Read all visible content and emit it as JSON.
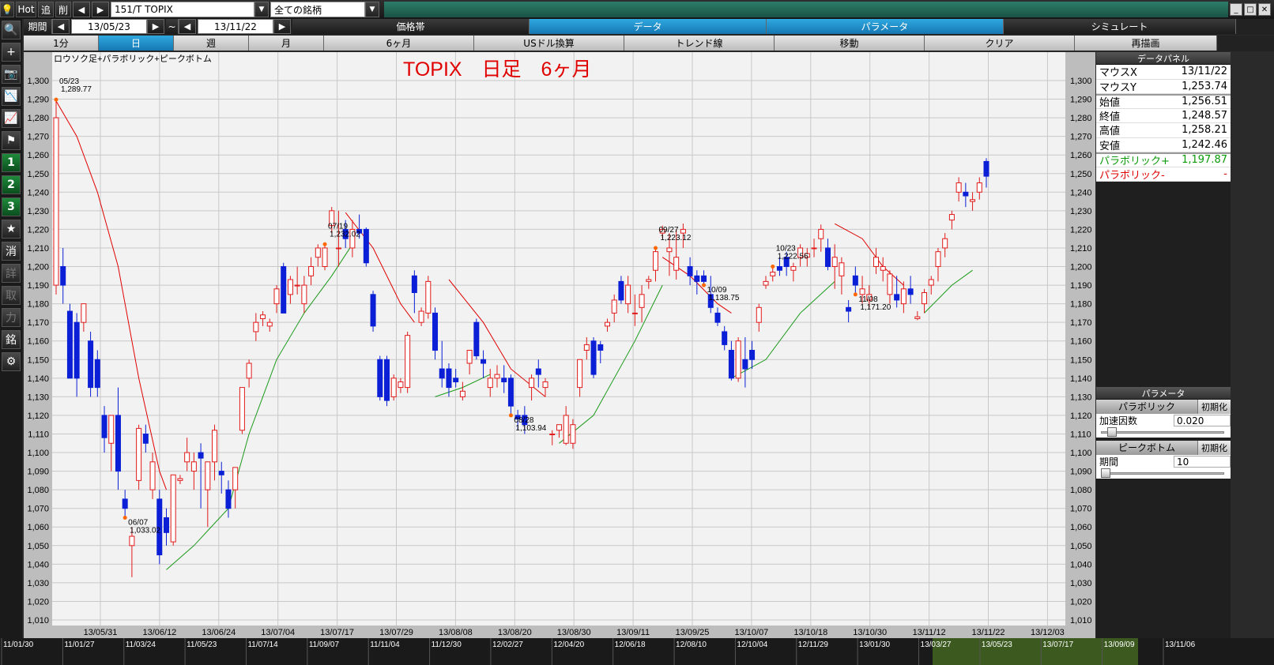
{
  "topbar": {
    "hot_label": "Hot",
    "add_label": "追",
    "del_label": "削",
    "prev_icon": "triangle-left-icon",
    "next_icon": "triangle-right-icon",
    "symbol_value": "151/T TOPIX",
    "filter_value": "全ての銘柄"
  },
  "row2": {
    "period_label": "期間",
    "start_date": "13/05/23",
    "tilde": "~",
    "end_date": "13/11/22",
    "tabs": [
      {
        "label": "価格帯"
      },
      {
        "label": "データ"
      },
      {
        "label": "パラメータ"
      },
      {
        "label": "シミュレート"
      }
    ]
  },
  "row3": {
    "buttons": [
      {
        "label": "1分"
      },
      {
        "label": "日"
      },
      {
        "label": "週"
      },
      {
        "label": "月"
      },
      {
        "label": "6ヶ月"
      },
      {
        "label": "USドル換算"
      },
      {
        "label": "トレンド線"
      },
      {
        "label": "移動"
      },
      {
        "label": "クリア"
      },
      {
        "label": "再描画"
      }
    ]
  },
  "left_tools": [
    {
      "icon": "magnifier-icon",
      "label": ""
    },
    {
      "icon": "plus-icon",
      "label": ""
    },
    {
      "icon": "camera-icon",
      "label": ""
    },
    {
      "icon": "line-chart-icon",
      "label": ""
    },
    {
      "icon": "indicator-chart-icon",
      "label": ""
    },
    {
      "icon": "flag-icon",
      "label": ""
    },
    {
      "icon": "",
      "label": "1"
    },
    {
      "icon": "",
      "label": "2"
    },
    {
      "icon": "",
      "label": "3"
    },
    {
      "icon": "star-icon",
      "label": ""
    },
    {
      "icon": "",
      "label": "消"
    },
    {
      "icon": "",
      "label": "詳"
    },
    {
      "icon": "",
      "label": "取"
    },
    {
      "icon": "",
      "label": "力"
    },
    {
      "icon": "",
      "label": "銘"
    },
    {
      "icon": "gear-icon",
      "label": ""
    }
  ],
  "chart_data": {
    "type": "candlestick",
    "subtitle": "ロウソク足+パラボリック+ピークボトム",
    "title": "TOPIX　日足　6ヶ月",
    "y_ticks": [
      "1,300",
      "1,290",
      "1,280",
      "1,270",
      "1,260",
      "1,250",
      "1,240",
      "1,230",
      "1,220",
      "1,210",
      "1,200",
      "1,190",
      "1,180",
      "1,170",
      "1,160",
      "1,150",
      "1,140",
      "1,130",
      "1,120",
      "1,110",
      "1,100",
      "1,090",
      "1,080",
      "1,070",
      "1,060",
      "1,050",
      "1,040",
      "1,030",
      "1,020",
      "1,010"
    ],
    "ylim": [
      1010,
      1300
    ],
    "x_ticks": [
      "13/05/31",
      "13/06/12",
      "13/06/24",
      "13/07/04",
      "13/07/17",
      "13/07/29",
      "13/08/08",
      "13/08/20",
      "13/08/30",
      "13/09/11",
      "13/09/25",
      "13/10/07",
      "13/10/18",
      "13/10/30",
      "13/11/12",
      "13/11/22",
      "13/12/03"
    ],
    "peak_labels": [
      {
        "date": "05/23",
        "value": "1,289.77",
        "type": "peak",
        "i": 0
      },
      {
        "date": "06/07",
        "value": "1,033.02",
        "type": "bottom",
        "i": 10
      },
      {
        "date": "07/19",
        "value": "1,232.02",
        "type": "peak",
        "i": 39
      },
      {
        "date": "08/28",
        "value": "1,103.94",
        "type": "bottom",
        "i": 66
      },
      {
        "date": "09/27",
        "value": "1,223.12",
        "type": "peak",
        "i": 87
      },
      {
        "date": "10/09",
        "value": "1,138.75",
        "type": "bottom",
        "i": 94
      },
      {
        "date": "10/23",
        "value": "1,222.56",
        "type": "peak",
        "i": 104
      },
      {
        "date": "11/08",
        "value": "1,171.20",
        "type": "bottom",
        "i": 116
      }
    ],
    "candles": [
      [
        1190,
        1289.77,
        1185,
        1280
      ],
      [
        1200,
        1210,
        1180,
        1190
      ],
      [
        1176,
        1180,
        1140,
        1140
      ],
      [
        1170,
        1175,
        1130,
        1140
      ],
      [
        1170,
        1180,
        1165,
        1180
      ],
      [
        1160,
        1165,
        1130,
        1135
      ],
      [
        1150,
        1155,
        1130,
        1135
      ],
      [
        1120,
        1125,
        1100,
        1108
      ],
      [
        1105,
        1120,
        1090,
        1120
      ],
      [
        1120,
        1135,
        1080,
        1090
      ],
      [
        1075,
        1080,
        1065,
        1070
      ],
      [
        1050,
        1060,
        1033.02,
        1055
      ],
      [
        1085,
        1115,
        1080,
        1113
      ],
      [
        1110,
        1115,
        1100,
        1105
      ],
      [
        1080,
        1100,
        1075,
        1095
      ],
      [
        1075,
        1080,
        1040,
        1045
      ],
      [
        1065,
        1070,
        1050,
        1057
      ],
      [
        1052,
        1088,
        1050,
        1088
      ],
      [
        1085,
        1088,
        1083,
        1086
      ],
      [
        1095,
        1108,
        1090,
        1100
      ],
      [
        1090,
        1100,
        1080,
        1095
      ],
      [
        1100,
        1105,
        1070,
        1097
      ],
      [
        1080,
        1090,
        1060,
        1095
      ],
      [
        1095,
        1115,
        1085,
        1112
      ],
      [
        1090,
        1095,
        1078,
        1088
      ],
      [
        1080,
        1085,
        1065,
        1070
      ],
      [
        1080,
        1090,
        1070,
        1092
      ],
      [
        1112,
        1135,
        1110,
        1135
      ],
      [
        1140,
        1150,
        1135,
        1148
      ],
      [
        1165,
        1175,
        1160,
        1170
      ],
      [
        1172,
        1176,
        1168,
        1174
      ],
      [
        1168,
        1172,
        1165,
        1170
      ],
      [
        1180,
        1190,
        1175,
        1188
      ],
      [
        1200,
        1202,
        1175,
        1175
      ],
      [
        1185,
        1195,
        1180,
        1193
      ],
      [
        1190,
        1200,
        1185,
        1190
      ],
      [
        1180,
        1195,
        1175,
        1190
      ],
      [
        1195,
        1205,
        1190,
        1200
      ],
      [
        1205,
        1212,
        1200,
        1210
      ],
      [
        1200,
        1212,
        1198,
        1210
      ],
      [
        1222,
        1232.02,
        1218,
        1230
      ],
      [
        1210,
        1230,
        1200,
        1210
      ],
      [
        1220,
        1225,
        1210,
        1215
      ],
      [
        1210,
        1225,
        1205,
        1220
      ],
      [
        1220,
        1228,
        1215,
        1218
      ],
      [
        1220,
        1221,
        1200,
        1202
      ],
      [
        1185,
        1187,
        1165,
        1168
      ],
      [
        1150,
        1152,
        1128,
        1130
      ],
      [
        1150,
        1152,
        1125,
        1128
      ],
      [
        1130,
        1142,
        1128,
        1140
      ],
      [
        1135,
        1140,
        1132,
        1138
      ],
      [
        1135,
        1165,
        1132,
        1163
      ],
      [
        1195,
        1198,
        1175,
        1186
      ],
      [
        1170,
        1178,
        1168,
        1176
      ],
      [
        1175,
        1195,
        1172,
        1192
      ],
      [
        1175,
        1178,
        1150,
        1155
      ],
      [
        1145,
        1160,
        1135,
        1140
      ],
      [
        1145,
        1148,
        1130,
        1135
      ],
      [
        1140,
        1145,
        1135,
        1138
      ],
      [
        1130,
        1138,
        1128,
        1133
      ],
      [
        1148,
        1155,
        1142,
        1155
      ],
      [
        1170,
        1172,
        1150,
        1152
      ],
      [
        1150,
        1155,
        1140,
        1148
      ],
      [
        1135,
        1145,
        1130,
        1140
      ],
      [
        1140,
        1147,
        1135,
        1142
      ],
      [
        1140,
        1147,
        1132,
        1138
      ],
      [
        1140,
        1142,
        1120,
        1125
      ],
      [
        1120,
        1123,
        1112,
        1118
      ],
      [
        1120,
        1125,
        1110,
        1115
      ],
      [
        1135,
        1142,
        1128,
        1140
      ],
      [
        1145,
        1150,
        1135,
        1142
      ],
      [
        1135,
        1140,
        1130,
        1138
      ],
      [
        1110,
        1112,
        1103.94,
        1110
      ],
      [
        1112,
        1115,
        1108,
        1115
      ],
      [
        1105,
        1125,
        1104,
        1120
      ],
      [
        1105,
        1118,
        1102,
        1115
      ],
      [
        1135,
        1150,
        1130,
        1150
      ],
      [
        1155,
        1162,
        1150,
        1158
      ],
      [
        1160,
        1162,
        1140,
        1142
      ],
      [
        1158,
        1160,
        1148,
        1155
      ],
      [
        1168,
        1172,
        1165,
        1170
      ],
      [
        1175,
        1185,
        1170,
        1182
      ],
      [
        1192,
        1195,
        1180,
        1182
      ],
      [
        1180,
        1195,
        1175,
        1190
      ],
      [
        1175,
        1185,
        1168,
        1175
      ],
      [
        1178,
        1190,
        1170,
        1185
      ],
      [
        1192,
        1195,
        1188,
        1193
      ],
      [
        1198,
        1210,
        1192,
        1208
      ],
      [
        1218,
        1222,
        1215,
        1220
      ],
      [
        1208,
        1218,
        1195,
        1210
      ],
      [
        1198,
        1220,
        1193,
        1205
      ],
      [
        1218,
        1223.12,
        1210,
        1220
      ],
      [
        1200,
        1205,
        1190,
        1195
      ],
      [
        1195,
        1198,
        1185,
        1192
      ],
      [
        1195,
        1198,
        1190,
        1192
      ],
      [
        1185,
        1195,
        1175,
        1178
      ],
      [
        1175,
        1178,
        1168,
        1170
      ],
      [
        1165,
        1168,
        1155,
        1158
      ],
      [
        1155,
        1160,
        1138.75,
        1140
      ],
      [
        1140,
        1162,
        1138,
        1160
      ],
      [
        1150,
        1162,
        1135,
        1145
      ],
      [
        1155,
        1160,
        1145,
        1150
      ],
      [
        1170,
        1180,
        1165,
        1178
      ],
      [
        1190,
        1195,
        1188,
        1192
      ],
      [
        1195,
        1200,
        1192,
        1197
      ],
      [
        1200,
        1205,
        1195,
        1198
      ],
      [
        1205,
        1208,
        1195,
        1200
      ],
      [
        1198,
        1202,
        1192,
        1200
      ],
      [
        1205,
        1212,
        1200,
        1210
      ],
      [
        1205,
        1210,
        1200,
        1207
      ],
      [
        1210,
        1215,
        1205,
        1210
      ],
      [
        1215,
        1222.56,
        1208,
        1220
      ],
      [
        1210,
        1215,
        1198,
        1200
      ],
      [
        1200,
        1212,
        1188,
        1205
      ],
      [
        1195,
        1205,
        1185,
        1202
      ],
      [
        1178,
        1182,
        1170,
        1176
      ],
      [
        1195,
        1200,
        1185,
        1190
      ],
      [
        1185,
        1195,
        1180,
        1188
      ],
      [
        1182,
        1190,
        1178,
        1185
      ],
      [
        1200,
        1210,
        1196,
        1205
      ],
      [
        1198,
        1205,
        1192,
        1200
      ],
      [
        1185,
        1198,
        1180,
        1196
      ],
      [
        1185,
        1195,
        1178,
        1182
      ],
      [
        1180,
        1192,
        1175,
        1188
      ],
      [
        1188,
        1195,
        1180,
        1185
      ],
      [
        1172,
        1176,
        1171.2,
        1173
      ],
      [
        1180,
        1188,
        1175,
        1186
      ],
      [
        1190,
        1195,
        1185,
        1193
      ],
      [
        1200,
        1210,
        1192,
        1208
      ],
      [
        1210,
        1218,
        1205,
        1215
      ],
      [
        1225,
        1230,
        1220,
        1228
      ],
      [
        1240,
        1248,
        1235,
        1245
      ],
      [
        1240,
        1245,
        1232,
        1238
      ],
      [
        1235,
        1240,
        1230,
        1236
      ],
      [
        1240,
        1248,
        1236,
        1245
      ],
      [
        1256.51,
        1258.21,
        1242.46,
        1248.57
      ]
    ],
    "candle_colors": {
      "up": "#e11a1a",
      "down": "#0a1fd6"
    },
    "psar_red_segments": [
      [
        [
          0,
          1289
        ],
        [
          3,
          1270
        ],
        [
          6,
          1240
        ],
        [
          9,
          1200
        ],
        [
          12,
          1140
        ],
        [
          15,
          1090
        ],
        [
          16,
          1080
        ]
      ],
      [
        [
          42,
          1229
        ],
        [
          46,
          1210
        ],
        [
          50,
          1180
        ],
        [
          52,
          1170
        ]
      ],
      [
        [
          57,
          1193
        ],
        [
          62,
          1170
        ],
        [
          66,
          1145
        ],
        [
          71,
          1130
        ]
      ],
      [
        [
          88,
          1205
        ],
        [
          92,
          1195
        ],
        [
          96,
          1180
        ],
        [
          98,
          1175
        ]
      ],
      [
        [
          113,
          1223
        ],
        [
          117,
          1215
        ],
        [
          120,
          1200
        ],
        [
          123,
          1190
        ]
      ]
    ],
    "psar_green_segments": [
      [
        [
          16,
          1037
        ],
        [
          20,
          1050
        ],
        [
          25,
          1070
        ],
        [
          28,
          1110
        ],
        [
          32,
          1150
        ],
        [
          36,
          1175
        ],
        [
          40,
          1195
        ],
        [
          43,
          1212
        ]
      ],
      [
        [
          55,
          1130
        ],
        [
          59,
          1135
        ],
        [
          63,
          1142
        ]
      ],
      [
        [
          73,
          1105
        ],
        [
          78,
          1120
        ],
        [
          84,
          1160
        ],
        [
          88,
          1190
        ]
      ],
      [
        [
          98,
          1140
        ],
        [
          103,
          1150
        ],
        [
          108,
          1175
        ],
        [
          113,
          1192
        ]
      ],
      [
        [
          126,
          1175
        ],
        [
          130,
          1190
        ],
        [
          133,
          1198
        ]
      ]
    ],
    "colors": {
      "background": "#f2f2f2",
      "grid": "#c8c8c8",
      "psar_up": "#1a9a1a",
      "psar_down": "#e00000",
      "title": "#e00000",
      "marker": "#ff6600"
    }
  },
  "bottom_dates": [
    "11/01/30",
    "11/01/27",
    "11/03/24",
    "11/05/23",
    "11/07/14",
    "11/09/07",
    "11/11/04",
    "11/12/30",
    "12/02/27",
    "12/04/20",
    "12/06/18",
    "12/08/10",
    "12/10/04",
    "12/11/29",
    "13/01/30",
    "13/03/27",
    "13/05/23",
    "13/07/17",
    "13/09/09",
    "13/11/06"
  ],
  "data_panel": {
    "header": "データパネル",
    "rows": [
      {
        "label": "マウスX",
        "value": "13/11/22",
        "cls": ""
      },
      {
        "label": "マウスY",
        "value": "1,253.74",
        "cls": ""
      },
      {
        "label": "始値",
        "value": "1,256.51",
        "cls": "sep"
      },
      {
        "label": "終値",
        "value": "1,248.57",
        "cls": ""
      },
      {
        "label": "高値",
        "value": "1,258.21",
        "cls": ""
      },
      {
        "label": "安値",
        "value": "1,242.46",
        "cls": ""
      },
      {
        "label": "パラボリック+",
        "value": "1,197.87",
        "cls": "green sep"
      },
      {
        "label": "パラボリック-",
        "value": "-",
        "cls": "red"
      }
    ]
  },
  "param_panel": {
    "header": "パラメータ",
    "sections": [
      {
        "name": "パラボリック",
        "reset": "初期化",
        "field_label": "加速因数",
        "field_value": "0.020",
        "slider": 0.06
      },
      {
        "name": "ピークボトム",
        "reset": "初期化",
        "field_label": "期間",
        "field_value": "10",
        "slider": 0.0
      }
    ]
  }
}
